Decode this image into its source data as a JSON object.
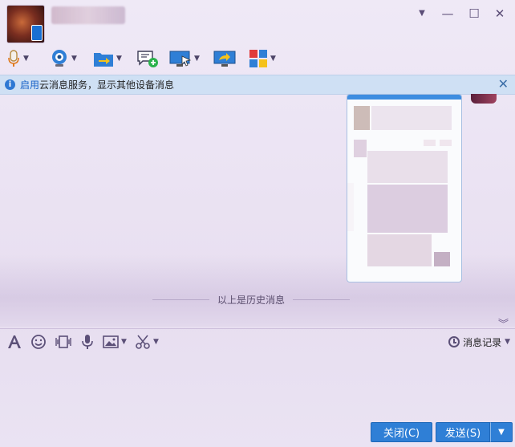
{
  "window": {
    "controls": [
      "▼",
      "—",
      "☐",
      "✕"
    ]
  },
  "toolbar": {
    "items": [
      {
        "name": "voice-call",
        "icon": "microphone-icon"
      },
      {
        "name": "video-call",
        "icon": "webcam-icon"
      },
      {
        "name": "send-file",
        "icon": "folder-send-icon"
      },
      {
        "name": "create-discussion",
        "icon": "chat-add-icon"
      },
      {
        "name": "remote-assist",
        "icon": "remote-desktop-icon"
      },
      {
        "name": "share-screen",
        "icon": "screen-share-icon"
      },
      {
        "name": "apps",
        "icon": "apps-grid-icon"
      }
    ]
  },
  "notice": {
    "link": "启用",
    "text": "云消息服务，显示其他设备消息"
  },
  "chat": {
    "history_label": "以上是历史消息"
  },
  "input_toolbar": {
    "history_label": "消息记录"
  },
  "buttons": {
    "close": "关闭(C)",
    "send": "发送(S)"
  },
  "colors": {
    "accent": "#2f7fd6",
    "notice_bg": "#cfe0f4",
    "link": "#1a63c8"
  }
}
